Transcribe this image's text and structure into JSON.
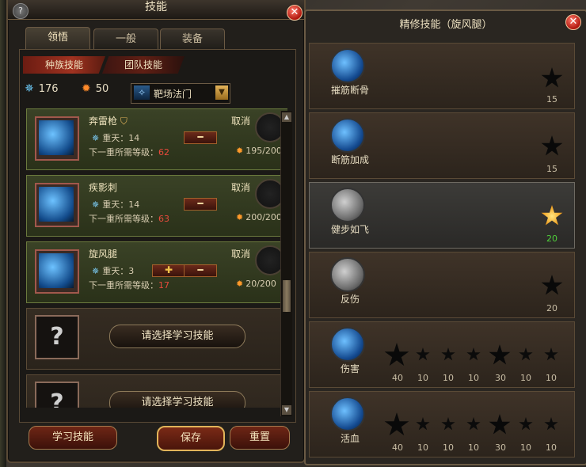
{
  "left_panel": {
    "title": "技能",
    "tabs": [
      {
        "label": "领悟"
      },
      {
        "label": "一般"
      },
      {
        "label": "装备"
      }
    ],
    "subtabs": [
      {
        "label": "种族技能"
      },
      {
        "label": "团队技能"
      }
    ],
    "resources": {
      "blue_points": "176",
      "fire_points": "50"
    },
    "select": {
      "value": "靶场法门"
    },
    "skills": [
      {
        "name": "奔雷枪",
        "cancel": "取消",
        "level_label": "重天：14",
        "next_label": "下一重所需等级：",
        "next_level": "62",
        "cost": "195/200"
      },
      {
        "name": "疾影刺",
        "cancel": "取消",
        "level_label": "重天：14",
        "next_label": "下一重所需等级：",
        "next_level": "63",
        "cost": "200/200"
      },
      {
        "name": "旋风腿",
        "cancel": "取消",
        "level_label": "重天：3",
        "next_label": "下一重所需等级：",
        "next_level": "17",
        "cost": "20/200"
      }
    ],
    "empty_slots": [
      {
        "button": "请选择学习技能"
      },
      {
        "button": "请选择学习技能"
      }
    ],
    "buttons": {
      "learn": "学习技能",
      "save": "保存",
      "reset": "重置"
    }
  },
  "right_panel": {
    "title": "精修技能（旋风腿）",
    "rows": [
      {
        "name": "摧筋断骨",
        "value": "15"
      },
      {
        "name": "断筋加成",
        "value": "15"
      },
      {
        "name": "健步如飞",
        "value": "20"
      },
      {
        "name": "反伤",
        "value": "20"
      },
      {
        "name": "伤害",
        "values": [
          "40",
          "10",
          "10",
          "10",
          "30",
          "10",
          "10"
        ]
      },
      {
        "name": "活血",
        "values": [
          "40",
          "10",
          "10",
          "10",
          "30",
          "10",
          "10"
        ]
      }
    ]
  },
  "colors": {
    "accent_red": "#a03220",
    "gold": "#e1b45a",
    "star_lit": "#f0a020"
  }
}
